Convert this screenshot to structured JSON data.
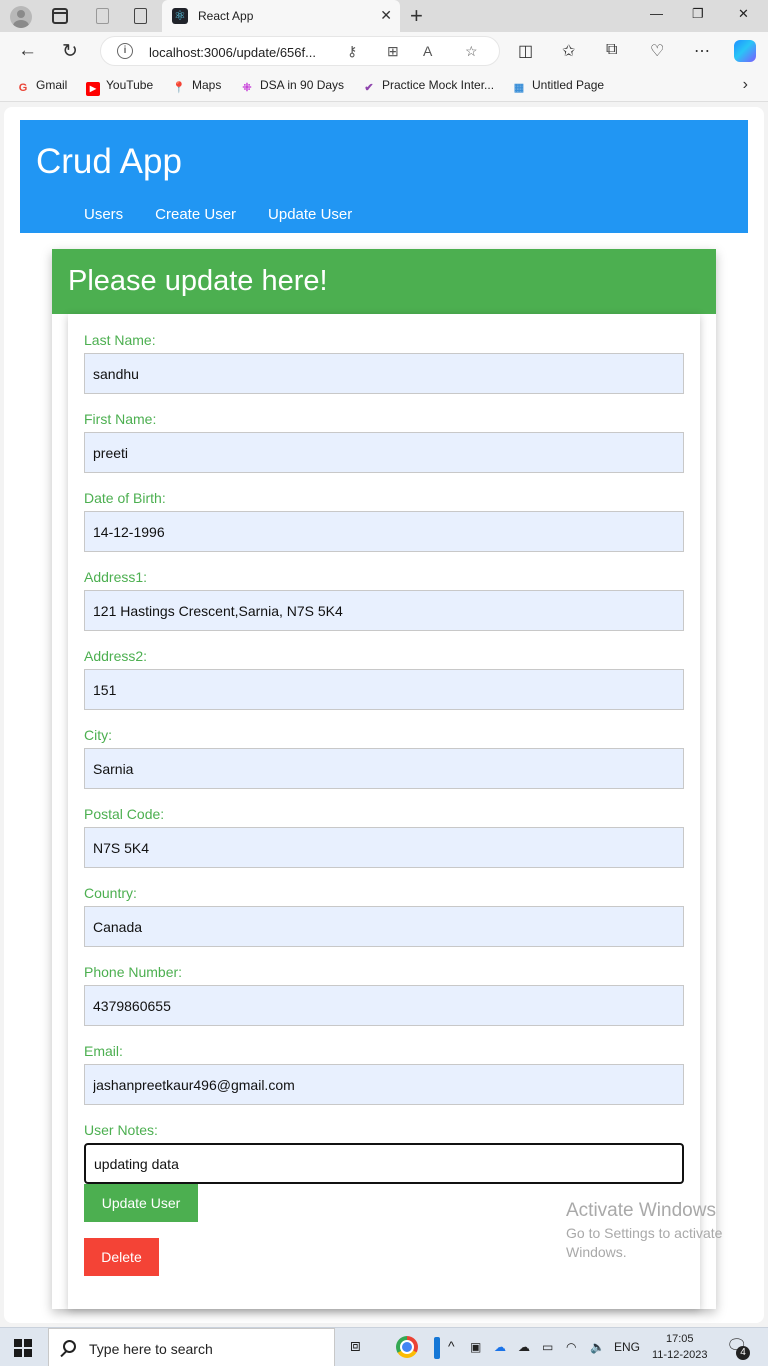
{
  "browser": {
    "tab_title": "React App",
    "url": "localhost:3006/update/656f...",
    "bookmarks": [
      {
        "label": "Gmail",
        "icon": "gmail-icon",
        "color": "#ea4335"
      },
      {
        "label": "YouTube",
        "icon": "youtube-icon",
        "color": "#ff0000"
      },
      {
        "label": "Maps",
        "icon": "maps-icon",
        "color": "#34a853"
      },
      {
        "label": "DSA in 90 Days",
        "icon": "dsa-icon",
        "color": "#c22ed6"
      },
      {
        "label": "Practice Mock Inter...",
        "icon": "check-icon",
        "color": "#8e44ad"
      },
      {
        "label": "Untitled Page",
        "icon": "page-icon",
        "color": "#3a8fd8"
      }
    ]
  },
  "app": {
    "title": "Crud App",
    "nav": [
      "Users",
      "Create User",
      "Update User"
    ],
    "colors": {
      "header": "#2196f3",
      "card_header": "#4caf50",
      "label": "#4caf50",
      "update_button": "#4caf50",
      "delete_button": "#f44336"
    }
  },
  "form": {
    "heading": "Please update here!",
    "fields": [
      {
        "label": "Last Name:",
        "value": "sandhu"
      },
      {
        "label": "First Name:",
        "value": "preeti"
      },
      {
        "label": "Date of Birth:",
        "value": "14-12-1996"
      },
      {
        "label": "Address1:",
        "value": "121 Hastings Crescent,Sarnia, N7S 5K4"
      },
      {
        "label": "Address2:",
        "value": "151"
      },
      {
        "label": "City:",
        "value": "Sarnia"
      },
      {
        "label": "Postal Code:",
        "value": "N7S 5K4"
      },
      {
        "label": "Country:",
        "value": "Canada"
      },
      {
        "label": "Phone Number:",
        "value": "4379860655"
      },
      {
        "label": "Email:",
        "value": "jashanpreetkaur496@gmail.com"
      },
      {
        "label": "User Notes:",
        "value": "updating data"
      }
    ],
    "update_label": "Update User",
    "delete_label": "Delete"
  },
  "watermark": {
    "title": "Activate Windows",
    "line1": "Go to Settings to activate",
    "line2": "Windows."
  },
  "taskbar": {
    "search_placeholder": "Type here to search",
    "language": "ENG",
    "time": "17:05",
    "date": "11-12-2023",
    "notification_count": "4"
  }
}
